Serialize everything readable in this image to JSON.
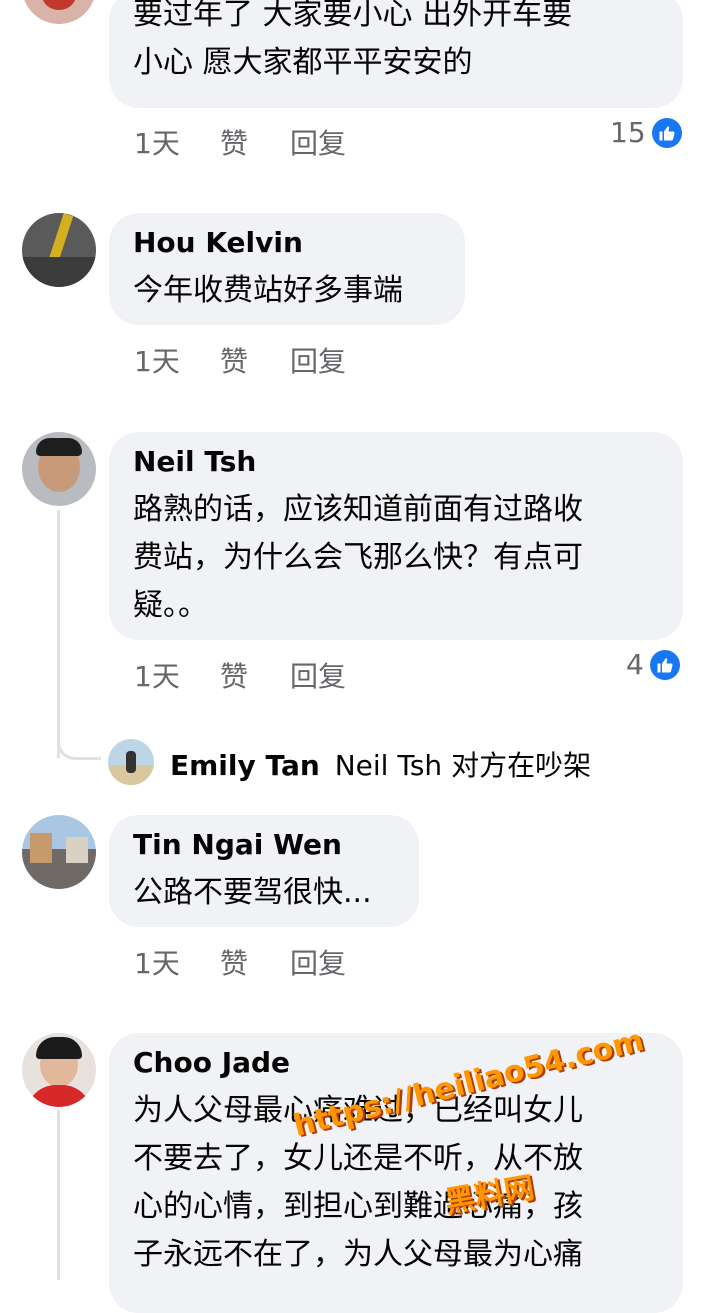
{
  "comments": [
    {
      "lines": [
        "要过年了 大家要小心 出外开车要",
        "小心 愿大家都平平安安的"
      ],
      "time": "1天",
      "like_label": "赞",
      "reply_label": "回复",
      "reactions": "15"
    },
    {
      "author": "Hou Kelvin",
      "lines": [
        "今年收费站好多事端"
      ],
      "time": "1天",
      "like_label": "赞",
      "reply_label": "回复"
    },
    {
      "author": "Neil Tsh",
      "lines": [
        "路熟的话，应该知道前面有过路收",
        "费站，为什么会飞那么快？有点可",
        "疑。。"
      ],
      "time": "1天",
      "like_label": "赞",
      "reply_label": "回复",
      "reactions": "4",
      "reply_preview": {
        "author": "Emily Tan",
        "text": "Neil Tsh 对方在吵架"
      }
    },
    {
      "author": "Tin Ngai Wen",
      "lines": [
        "公路不要驾很快..."
      ],
      "time": "1天",
      "like_label": "赞",
      "reply_label": "回复"
    },
    {
      "author": "Choo Jade",
      "lines": [
        "为人父母最心痛难过，已经叫女儿",
        "不要去了，女儿还是不听，从不放",
        "心的心情，到担心到難過心痛，孩",
        "子永远不在了，为人父母最为心痛"
      ]
    }
  ],
  "watermark": {
    "url": "https://heiliao54.com",
    "brand": "黑料网"
  },
  "colors": {
    "bubble": "#f0f2f5",
    "meta": "#65676b",
    "like_blue": "#1877f2",
    "watermark": "#ff9800"
  }
}
